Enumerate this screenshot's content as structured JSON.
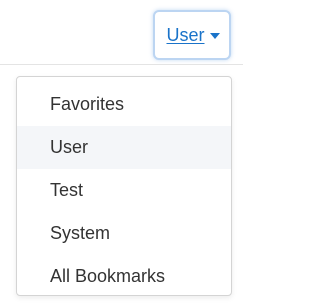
{
  "dropdown": {
    "selected_label": "User",
    "items": [
      {
        "label": "Favorites"
      },
      {
        "label": "User"
      },
      {
        "label": "Test"
      },
      {
        "label": "System"
      },
      {
        "label": "All Bookmarks"
      }
    ]
  },
  "colors": {
    "link": "#1a73c9",
    "focus_border": "#bcd5f2",
    "hover_bg": "#f4f6f9"
  }
}
